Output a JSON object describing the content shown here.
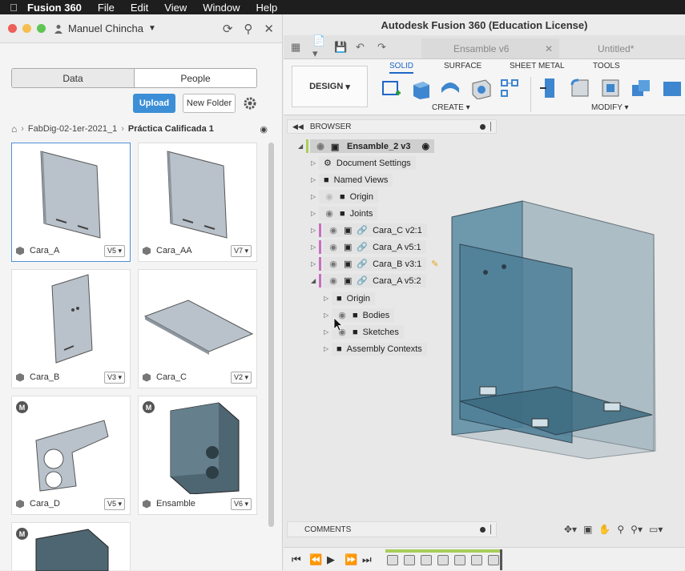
{
  "menubar": {
    "apple_icon": "apple-logo",
    "app_name": "Fusion 360",
    "items": [
      "File",
      "Edit",
      "View",
      "Window",
      "Help"
    ]
  },
  "data_panel": {
    "user_name": "Manuel Chincha",
    "segments": [
      "Data",
      "People"
    ],
    "active_segment": "Data",
    "upload_label": "Upload",
    "new_folder_label": "New Folder",
    "breadcrumb": {
      "parent": "FabDig-02-1er-2021_1",
      "current": "Práctica Calificada 1"
    },
    "files": [
      {
        "name": "Cara_A",
        "version": "V5",
        "badge": "",
        "selected": true
      },
      {
        "name": "Cara_AA",
        "version": "V7",
        "badge": ""
      },
      {
        "name": "Cara_B",
        "version": "V3",
        "badge": ""
      },
      {
        "name": "Cara_C",
        "version": "V2",
        "badge": ""
      },
      {
        "name": "Cara_D",
        "version": "V5",
        "badge": "M"
      },
      {
        "name": "Ensamble",
        "version": "V6",
        "badge": "M"
      },
      {
        "badge": "M"
      }
    ]
  },
  "fusion": {
    "window_title": "Autodesk Fusion 360 (Education License)",
    "doc_tabs": [
      {
        "label": "Ensamble v6",
        "active": true
      },
      {
        "label": "Untitled*",
        "active": false
      }
    ],
    "workspace": "DESIGN",
    "toolbar_tabs": [
      "SOLID",
      "SURFACE",
      "SHEET METAL",
      "TOOLS"
    ],
    "active_toolbar_tab": "SOLID",
    "groups": {
      "create": "CREATE",
      "modify": "MODIFY"
    },
    "browser": {
      "title": "BROWSER",
      "root": "Ensamble_2 v3",
      "nodes": [
        "Document Settings",
        "Named Views",
        "Origin",
        "Joints",
        "Cara_C v2:1",
        "Cara_A v5:1",
        "Cara_B v3:1",
        "Cara_A v5:2",
        "Origin",
        "Bodies",
        "Sketches",
        "Assembly Contexts"
      ]
    },
    "comments_label": "COMMENTS"
  },
  "colors": {
    "accent": "#1f66c7",
    "upload": "#3c8fd6",
    "component_mark": "#c86fc0",
    "timeline": "#a7cf5a",
    "panel_blue": "#5f8fa6"
  }
}
